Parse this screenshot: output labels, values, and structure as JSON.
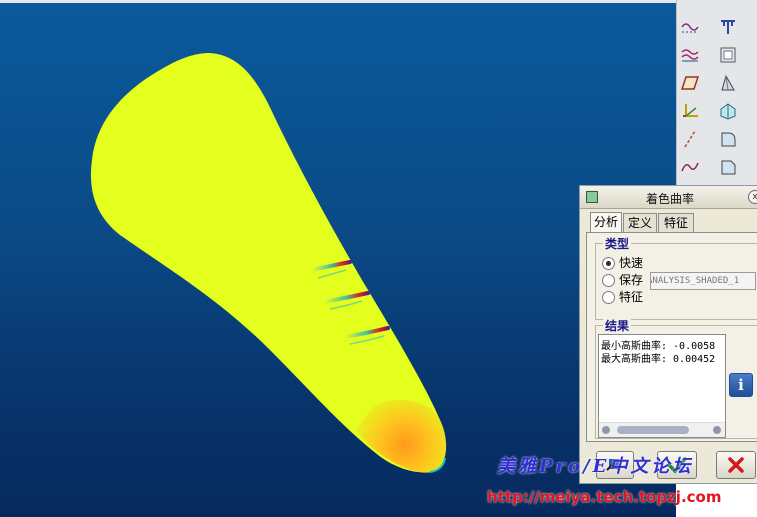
{
  "dialog": {
    "title": "着色曲率",
    "close_glyph": "x",
    "tabs": [
      {
        "label": "分析",
        "active": true
      },
      {
        "label": "定义",
        "active": false
      },
      {
        "label": "特征",
        "active": false
      }
    ],
    "type_group": {
      "label": "类型",
      "options": [
        {
          "label": "快速",
          "selected": true
        },
        {
          "label": "保存",
          "selected": false
        },
        {
          "label": "特征",
          "selected": false
        }
      ],
      "analysis_name": "ANALYSIS_SHADED_1"
    },
    "results_group": {
      "label": "结果",
      "lines": [
        "最小高斯曲率: -0.0058",
        "最大高斯曲率: 0.00452"
      ]
    },
    "info_glyph": "i"
  },
  "toolbar": {
    "icons": [
      "curve-on-surface-icon",
      "datum-plane-icon",
      "wavy-surface-icon",
      "offset-box-icon",
      "parallelogram-icon",
      "draft-icon",
      "coordinate-system-icon",
      "shell-icon",
      "axis-line-icon",
      "round-icon",
      "sketch-curve-icon",
      "chamfer-icon"
    ]
  },
  "watermark": {
    "text": "美雅Pro/E中文论坛",
    "url": "http://meiya.tech.topzj.com"
  },
  "colors": {
    "background_top": "#0a5a9c",
    "background_bottom": "#062a5e",
    "surface": "#e4ff1e",
    "accent_red": "#e51c1c",
    "watermark_blue": "#2f2fd6"
  }
}
